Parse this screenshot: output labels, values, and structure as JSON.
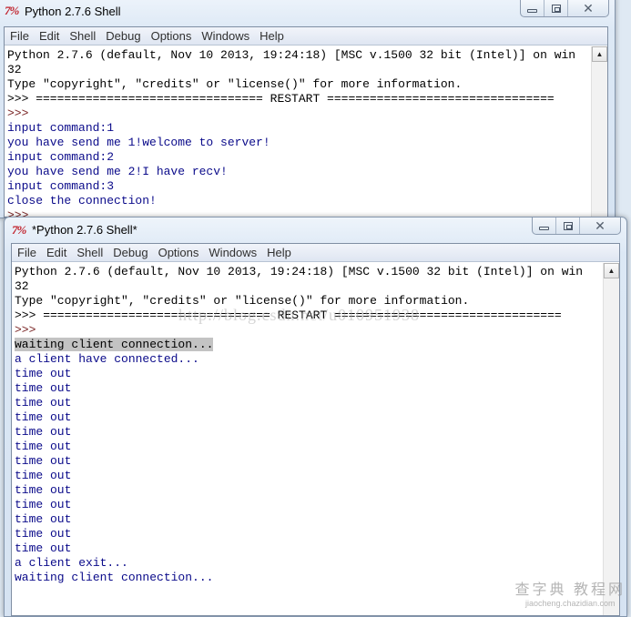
{
  "window1": {
    "title": "Python 2.7.6 Shell",
    "icon": "7%",
    "menu": [
      "File",
      "Edit",
      "Shell",
      "Debug",
      "Options",
      "Windows",
      "Help"
    ],
    "lines": [
      {
        "text": "Python 2.7.6 (default, Nov 10 2013, 19:24:18) [MSC v.1500 32 bit (Intel)] on win",
        "style": "normal"
      },
      {
        "text": "32",
        "style": "normal"
      },
      {
        "text": "Type \"copyright\", \"credits\" or \"license()\" for more information.",
        "style": "normal"
      },
      {
        "text": ">>> ================================ RESTART ================================",
        "style": "normal"
      },
      {
        "text": ">>> ",
        "style": "prompt"
      },
      {
        "text": "input command:1",
        "style": "out"
      },
      {
        "text": "you have send me 1!welcome to server!",
        "style": "out"
      },
      {
        "text": "input command:2",
        "style": "out"
      },
      {
        "text": "you have send me 2!I have recv!",
        "style": "out"
      },
      {
        "text": "input command:3",
        "style": "out"
      },
      {
        "text": "close the connection!",
        "style": "out"
      },
      {
        "text": ">>> ",
        "style": "prompt"
      }
    ]
  },
  "window2": {
    "title": "*Python 2.7.6 Shell*",
    "icon": "7%",
    "menu": [
      "File",
      "Edit",
      "Shell",
      "Debug",
      "Options",
      "Windows",
      "Help"
    ],
    "lines": [
      {
        "text": "Python 2.7.6 (default, Nov 10 2013, 19:24:18) [MSC v.1500 32 bit (Intel)] on win",
        "style": "normal"
      },
      {
        "text": "32",
        "style": "normal"
      },
      {
        "text": "Type \"copyright\", \"credits\" or \"license()\" for more information.",
        "style": "normal"
      },
      {
        "text": ">>> ================================ RESTART ================================",
        "style": "normal"
      },
      {
        "text": ">>> ",
        "style": "prompt"
      },
      {
        "text": "waiting client connection...",
        "style": "sel"
      },
      {
        "text": "a client have connected...",
        "style": "out"
      },
      {
        "text": "time out",
        "style": "out"
      },
      {
        "text": "time out",
        "style": "out"
      },
      {
        "text": "time out",
        "style": "out"
      },
      {
        "text": "time out",
        "style": "out"
      },
      {
        "text": "time out",
        "style": "out"
      },
      {
        "text": "time out",
        "style": "out"
      },
      {
        "text": "time out",
        "style": "out"
      },
      {
        "text": "time out",
        "style": "out"
      },
      {
        "text": "time out",
        "style": "out"
      },
      {
        "text": "time out",
        "style": "out"
      },
      {
        "text": "time out",
        "style": "out"
      },
      {
        "text": "time out",
        "style": "out"
      },
      {
        "text": "time out",
        "style": "out"
      },
      {
        "text": "a client exit...",
        "style": "out"
      },
      {
        "text": "waiting client connection...",
        "style": "out"
      }
    ]
  },
  "controls": {
    "minimize": "minimize",
    "maximize": "restore",
    "close": "✕"
  },
  "scroll_arrow": "▲",
  "watermarks": {
    "url": "http://blog.csdn.net/u010951938",
    "site_top": "查字典 教程网",
    "site_bottom": "jiaocheng.chazidian.com"
  }
}
